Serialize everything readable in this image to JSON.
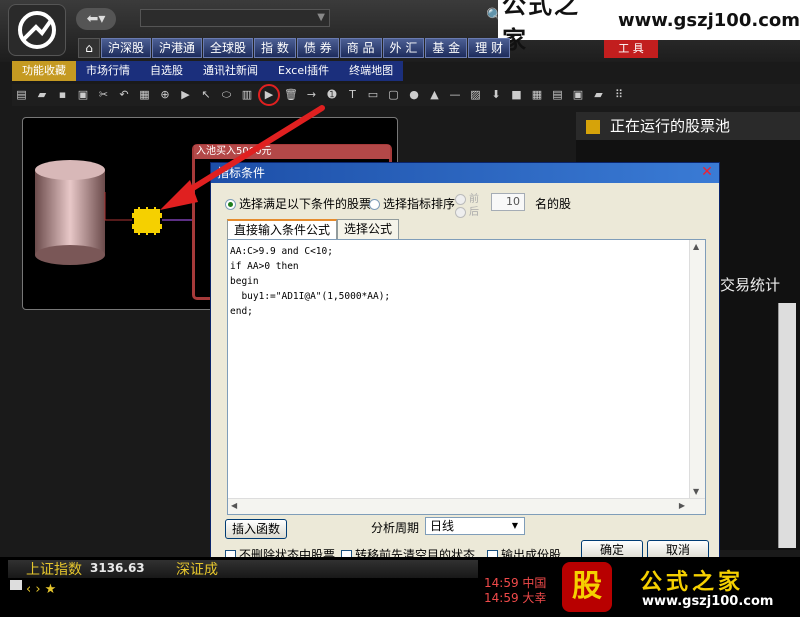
{
  "brand": {
    "name": "公式之家",
    "url": "www.gszj100.com"
  },
  "market_tabs": [
    "沪深股",
    "沪港通",
    "全球股",
    "指 数",
    "债 券",
    "商 品",
    "外 汇",
    "基 金",
    "理 财"
  ],
  "tool_label": "工 具",
  "menu": [
    "功能收藏",
    "市场行情",
    "自选股",
    "通讯社新闻",
    "Excel插件",
    "终端地图"
  ],
  "pool_window_title": "入池买入5000元",
  "right_panel": {
    "running_pool": "正在运行的股票池",
    "trade_stats": "交易统计"
  },
  "dialog": {
    "title": "指标条件",
    "radio_condition": "选择满足以下条件的股票",
    "radio_rank": "选择指标排序",
    "radio_front": "前",
    "radio_back": "后",
    "count_value": "10",
    "count_suffix": "名的股",
    "tab_direct": "直接输入条件公式",
    "tab_select": "选择公式",
    "code": "AA:C>9.9 and C<10;\nif AA>0 then\nbegin\n  buy1:=\"AD1I@A\"(1,5000*AA);\nend;",
    "insert_function": "插入函数",
    "period_label": "分析周期",
    "period_value": "日线",
    "chk_no_delete": "不删除状态中股票",
    "chk_clear_empty": "转移前先清空目的状态",
    "chk_export": "输出成份股",
    "ok": "确定",
    "cancel": "取消"
  },
  "index_bar": {
    "name": "上证指数",
    "value": "3136.63",
    "name2": "深证成"
  },
  "ticker": [
    "14:59 中国",
    "14:59 大幸"
  ],
  "bottom_brand": {
    "gu": "股",
    "name": "公式之家",
    "url": "www.gszj100.com"
  },
  "colors": {
    "menu_active": "#c59a22",
    "menu_bar": "#1b2f7c",
    "dialog_title": "#1d4fa8",
    "annotation_red": "#e02020",
    "index_text": "#e6c62d"
  }
}
